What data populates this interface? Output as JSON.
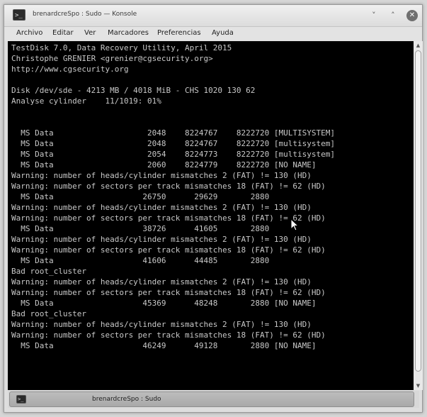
{
  "window": {
    "title": "brenardcreSpo : Sudo — Konsole",
    "app_icon": "terminal-icon"
  },
  "window_buttons": [
    {
      "name": "minimize-button",
      "icon": "chevron-down-icon",
      "glyph": "˅"
    },
    {
      "name": "maximize-button",
      "icon": "chevron-up-icon",
      "glyph": "˄"
    },
    {
      "name": "close-button",
      "icon": "close-icon",
      "glyph": "✕"
    }
  ],
  "menu": [
    {
      "label": "Archivo"
    },
    {
      "label": "Editar"
    },
    {
      "label": "Ver"
    },
    {
      "label": "Marcadores"
    },
    {
      "label": "Preferencias"
    },
    {
      "label": "Ayuda"
    }
  ],
  "terminal": {
    "lines": [
      "TestDisk 7.0, Data Recovery Utility, April 2015",
      "Christophe GRENIER <grenier@cgsecurity.org>",
      "http://www.cgsecurity.org",
      "",
      "Disk /dev/sde - 4213 MB / 4018 MiB - CHS 1020 130 62",
      "Analyse cylinder    11/1019: 01%",
      "",
      "",
      "  MS Data                    2048    8224767    8222720 [MULTISYSTEM]",
      "  MS Data                    2048    8224767    8222720 [multisystem]",
      "  MS Data                    2054    8224773    8222720 [multisystem]",
      "  MS Data                    2060    8224779    8222720 [NO NAME]",
      "Warning: number of heads/cylinder mismatches 2 (FAT) != 130 (HD)",
      "Warning: number of sectors per track mismatches 18 (FAT) != 62 (HD)",
      "  MS Data                   26750      29629       2880",
      "Warning: number of heads/cylinder mismatches 2 (FAT) != 130 (HD)",
      "Warning: number of sectors per track mismatches 18 (FAT) != 62 (HD)",
      "  MS Data                   38726      41605       2880",
      "Warning: number of heads/cylinder mismatches 2 (FAT) != 130 (HD)",
      "Warning: number of sectors per track mismatches 18 (FAT) != 62 (HD)",
      "  MS Data                   41606      44485       2880",
      "Bad root_cluster",
      "Warning: number of heads/cylinder mismatches 2 (FAT) != 130 (HD)",
      "Warning: number of sectors per track mismatches 18 (FAT) != 62 (HD)",
      "  MS Data                   45369      48248       2880 [NO NAME]",
      "Bad root_cluster",
      "Warning: number of heads/cylinder mismatches 2 (FAT) != 130 (HD)",
      "Warning: number of sectors per track mismatches 18 (FAT) != 62 (HD)",
      "  MS Data                   46249      49128       2880 [NO NAME]"
    ]
  },
  "colors": {
    "terminal_background": "#000000",
    "terminal_foreground": "#c8c8c8"
  },
  "scrollbar": {
    "up_glyph": "▲",
    "down_glyph": "▼",
    "position_fraction": 0.0
  },
  "tab": {
    "label": "brenardcreSpo : Sudo",
    "icon": "terminal-icon"
  }
}
